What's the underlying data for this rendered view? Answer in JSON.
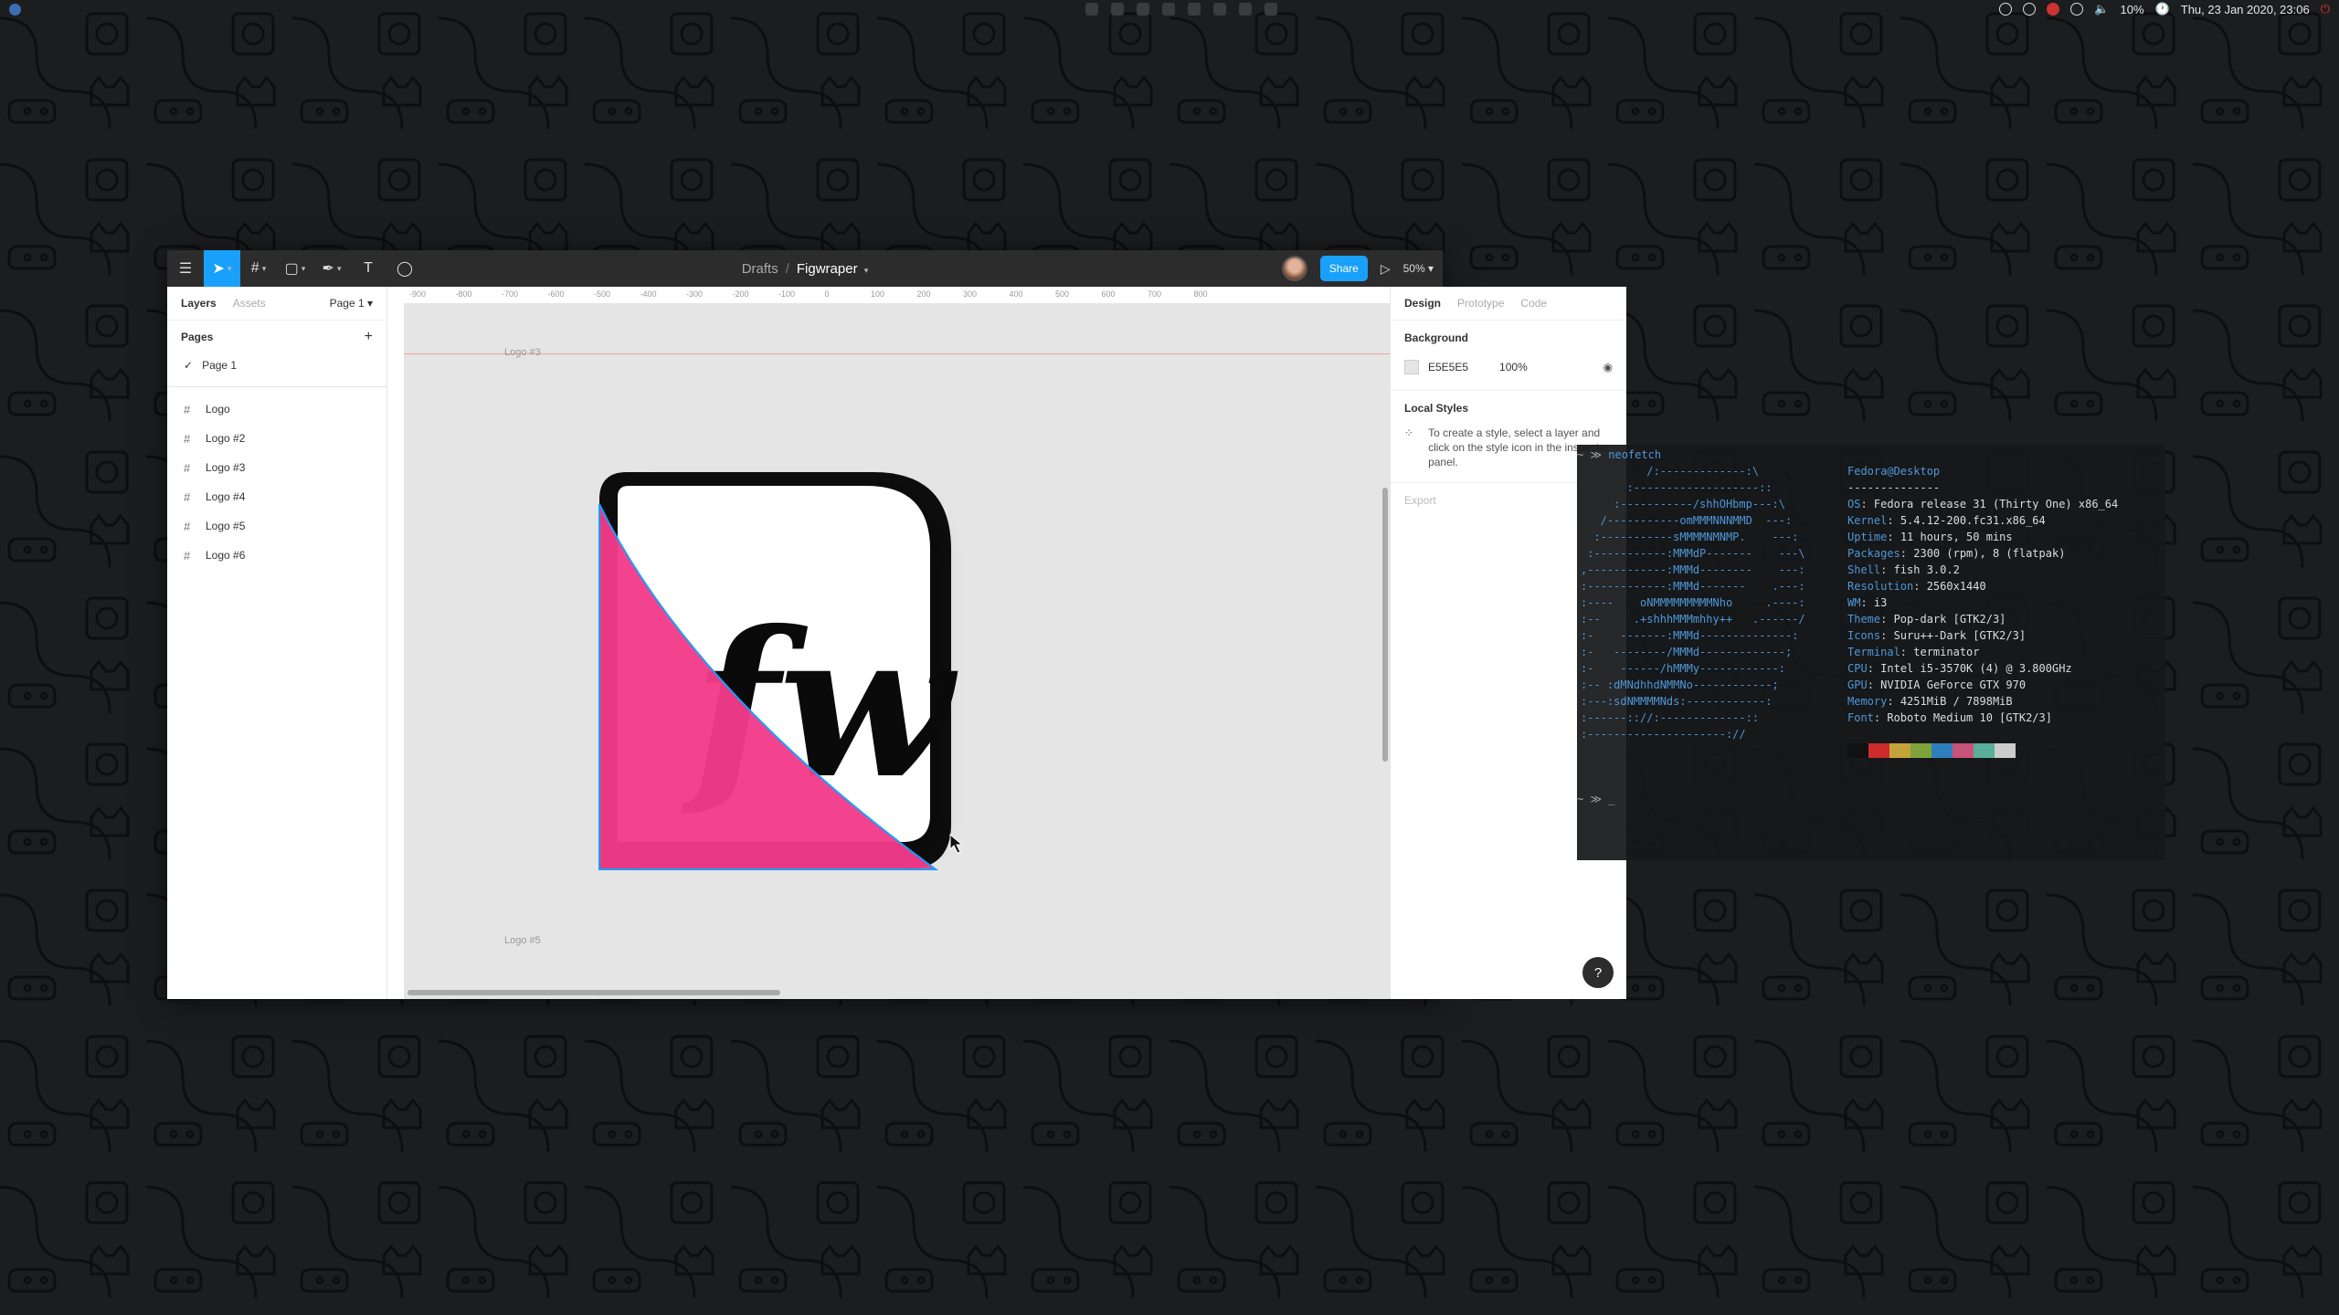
{
  "system_bar": {
    "volume": "10%",
    "datetime": "Thu, 23 Jan 2020, 23:06"
  },
  "figma": {
    "breadcrumb": "Drafts",
    "file_name": "Figwraper",
    "share_label": "Share",
    "zoom": "50%",
    "left_panel": {
      "tab_layers": "Layers",
      "tab_assets": "Assets",
      "page_selector": "Page 1",
      "pages_title": "Pages",
      "pages": [
        "Page 1"
      ],
      "layers": [
        "Logo",
        "Logo #2",
        "Logo #3",
        "Logo #4",
        "Logo #5",
        "Logo #6"
      ]
    },
    "canvas": {
      "ruler_ticks": [
        "-900",
        "-800",
        "-700",
        "-600",
        "-500",
        "-400",
        "-300",
        "-200",
        "-100",
        "0",
        "100",
        "200",
        "300",
        "400",
        "500",
        "600",
        "700",
        "800"
      ],
      "frame_label_top": "Logo #3",
      "frame_label_bottom": "Logo #5",
      "logo_text": "fw"
    },
    "right_panel": {
      "tab_design": "Design",
      "tab_prototype": "Prototype",
      "tab_code": "Code",
      "background_title": "Background",
      "background_hex": "E5E5E5",
      "background_opacity": "100%",
      "local_styles_title": "Local Styles",
      "local_styles_hint": "To create a style, select a layer and click on the style icon in the inspector panel.",
      "export_title": "Export"
    },
    "help": "?"
  },
  "terminal": {
    "prompt": "~ ≫",
    "command": "neofetch",
    "ascii_art": "          /:-------------:\\\n       :-------------------::\n     :-----------/shhOHbmp---:\\\n   /-----------omMMMNNNMMD  ---:\n  :-----------sMMMMNMNMP.    ---:\n :-----------:MMMdP-------    ---\\\n,------------:MMMd--------    ---:\n:------------:MMMd-------    .---:\n:----    oNMMMMMMMMMNho     .----:\n:--     .+shhhMMMmhhy++   .------/\n:-    -------:MMMd--------------:\n:-   --------/MMMd-------------;\n:-    ------/hMMMy------------:\n:-- :dMNdhhdNMMNo------------;\n:---:sdNMMMMNds:------------:\n:------:://:-------------::\n:---------------------://",
    "user_host": "Fedora@Desktop",
    "separator": "--------------",
    "info": [
      {
        "key": "OS",
        "value": "Fedora release 31 (Thirty One) x86_64"
      },
      {
        "key": "Kernel",
        "value": "5.4.12-200.fc31.x86_64"
      },
      {
        "key": "Uptime",
        "value": "11 hours, 50 mins"
      },
      {
        "key": "Packages",
        "value": "2300 (rpm), 8 (flatpak)"
      },
      {
        "key": "Shell",
        "value": "fish 3.0.2"
      },
      {
        "key": "Resolution",
        "value": "2560x1440"
      },
      {
        "key": "WM",
        "value": "i3"
      },
      {
        "key": "Theme",
        "value": "Pop-dark [GTK2/3]"
      },
      {
        "key": "Icons",
        "value": "Suru++-Dark [GTK2/3]"
      },
      {
        "key": "Terminal",
        "value": "terminator"
      },
      {
        "key": "CPU",
        "value": "Intel i5-3570K (4) @ 3.800GHz"
      },
      {
        "key": "GPU",
        "value": "NVIDIA GeForce GTX 970"
      },
      {
        "key": "Memory",
        "value": "4251MiB / 7898MiB"
      },
      {
        "key": "Font",
        "value": "Roboto Medium 10 [GTK2/3]"
      }
    ],
    "palette": [
      "#111111",
      "#cc2c2c",
      "#c4a43a",
      "#7fa33a",
      "#2f7fbf",
      "#c7527a",
      "#5aae9a",
      "#cccccc"
    ],
    "prompt2": "~ ≫ _"
  }
}
